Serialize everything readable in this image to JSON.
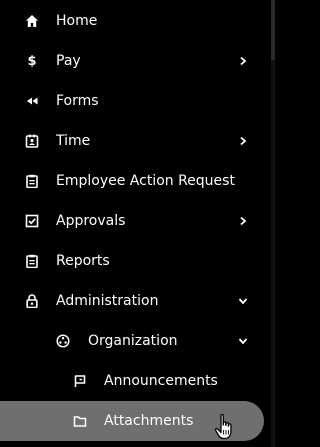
{
  "nav": {
    "home": {
      "label": "Home",
      "icon": "home-icon"
    },
    "pay": {
      "label": "Pay",
      "icon": "dollar-icon"
    },
    "forms": {
      "label": "Forms",
      "icon": "rewind-icon"
    },
    "time": {
      "label": "Time",
      "icon": "badge-icon"
    },
    "ear": {
      "label": "Employee Action Request",
      "icon": "clipboard-icon"
    },
    "approvals": {
      "label": "Approvals",
      "icon": "checkbox-icon"
    },
    "reports": {
      "label": "Reports",
      "icon": "clipboard-icon"
    },
    "administration": {
      "label": "Administration",
      "icon": "lock-icon"
    },
    "organization": {
      "label": "Organization",
      "icon": "org-icon"
    },
    "announcements": {
      "label": "Announcements",
      "icon": "flag-icon"
    },
    "attachments": {
      "label": "Attachments",
      "icon": "folder-icon"
    }
  },
  "colors": {
    "background": "#000000",
    "text": "#ffffff",
    "active": "#6f6f6f"
  }
}
